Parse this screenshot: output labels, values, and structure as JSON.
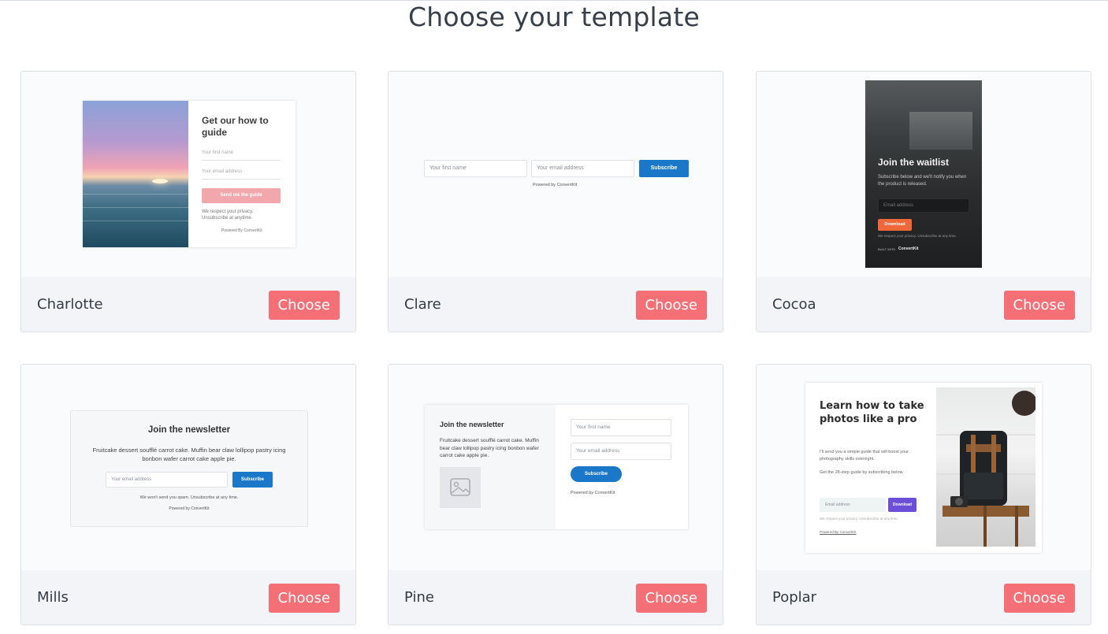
{
  "page": {
    "title": "Choose your template"
  },
  "choose_label": "Choose",
  "colors": {
    "choose_button": "#f56f76",
    "blue_button": "#1b78c9",
    "cocoa_orange": "#f0683a",
    "poplar_purple": "#6b4fd8",
    "charlotte_pink": "#f2a7ac"
  },
  "templates": [
    {
      "name": "Charlotte",
      "preview": {
        "heading": "Get our how to guide",
        "first_name_placeholder": "Your first name",
        "email_placeholder": "Your email address",
        "button": "Send me the guide",
        "privacy": "We respect your privacy. Unsubscribe at anytime.",
        "powered": "Powered By ConvertKit"
      }
    },
    {
      "name": "Clare",
      "preview": {
        "first_name_placeholder": "Your first name",
        "email_placeholder": "Your email address",
        "button": "Subscribe",
        "powered": "Powered by ConvertKit"
      }
    },
    {
      "name": "Cocoa",
      "preview": {
        "heading": "Join the waitlist",
        "text": "Subscribe below and we'll notify you when the product is released.",
        "email_placeholder": "Email address",
        "button": "Download",
        "privacy": "We respect your privacy. Unsubscribe at any time.",
        "built_with": "BUILT WITH",
        "brand": "ConvertKit"
      }
    },
    {
      "name": "Mills",
      "preview": {
        "heading": "Join the newsletter",
        "text": "Fruitcake dessert soufflé carrot cake. Muffin bear claw lollipop pastry icing bonbon wafer carrot cake apple pie.",
        "email_placeholder": "Your email address",
        "button": "Subscribe",
        "spam": "We won't send you spam. Unsubscribe at any time.",
        "powered": "Powered by ConvertKit"
      }
    },
    {
      "name": "Pine",
      "preview": {
        "heading": "Join the newsletter",
        "text": "Fruitcake dessert soufflé carrot cake. Muffin bear claw lollipop pastry icing bonbon wafer carrot cake apple pie.",
        "first_name_placeholder": "Your first name",
        "email_placeholder": "Your email address",
        "button": "Subscribe",
        "powered": "Powered by ConvertKit"
      }
    },
    {
      "name": "Poplar",
      "preview": {
        "heading": "Learn how to take photos like a pro",
        "text1": "I'll send you a simple guide that will boost your photography skills overnight.",
        "text2": "Get the 28-step guide by subscribing below.",
        "email_placeholder": "Email address",
        "button": "Download",
        "privacy": "We respect your privacy. Unsubscribe at any time.",
        "powered": "Powered By ConvertKit"
      }
    }
  ]
}
